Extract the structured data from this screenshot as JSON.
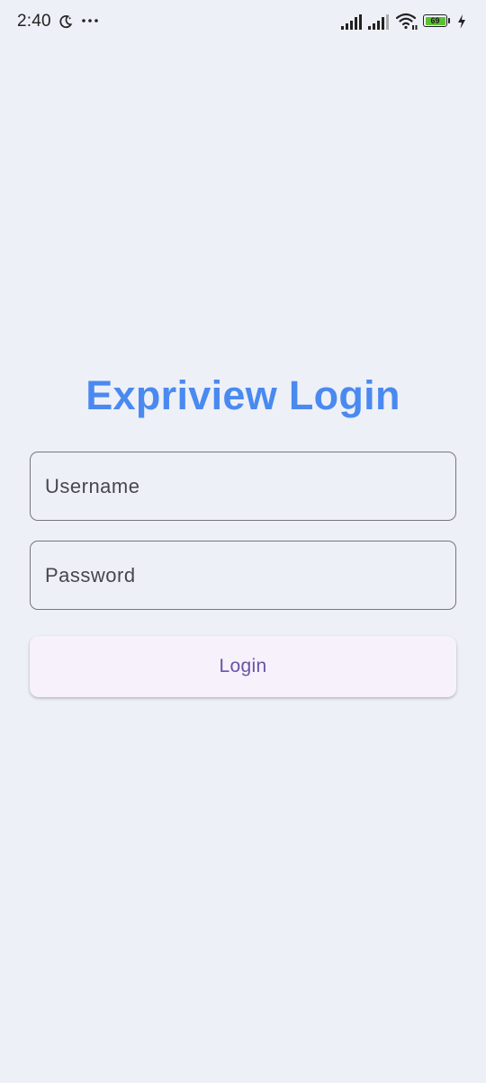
{
  "status_bar": {
    "time": "2:40",
    "battery_level": "69",
    "icons": [
      "moon-icon",
      "more-dots-icon",
      "signal-icon",
      "signal-icon",
      "wifi-icon",
      "battery-icon",
      "charging-bolt-icon"
    ]
  },
  "login": {
    "title": "Expriview Login",
    "username_placeholder": "Username",
    "username_value": "",
    "password_placeholder": "Password",
    "password_value": "",
    "button_label": "Login"
  },
  "colors": {
    "background": "#eef0f8",
    "title": "#4a8af0",
    "button_text": "#6a52a6",
    "button_bg": "#f6f1fa",
    "field_border": "#77757e",
    "battery_fill": "#5ac232"
  }
}
